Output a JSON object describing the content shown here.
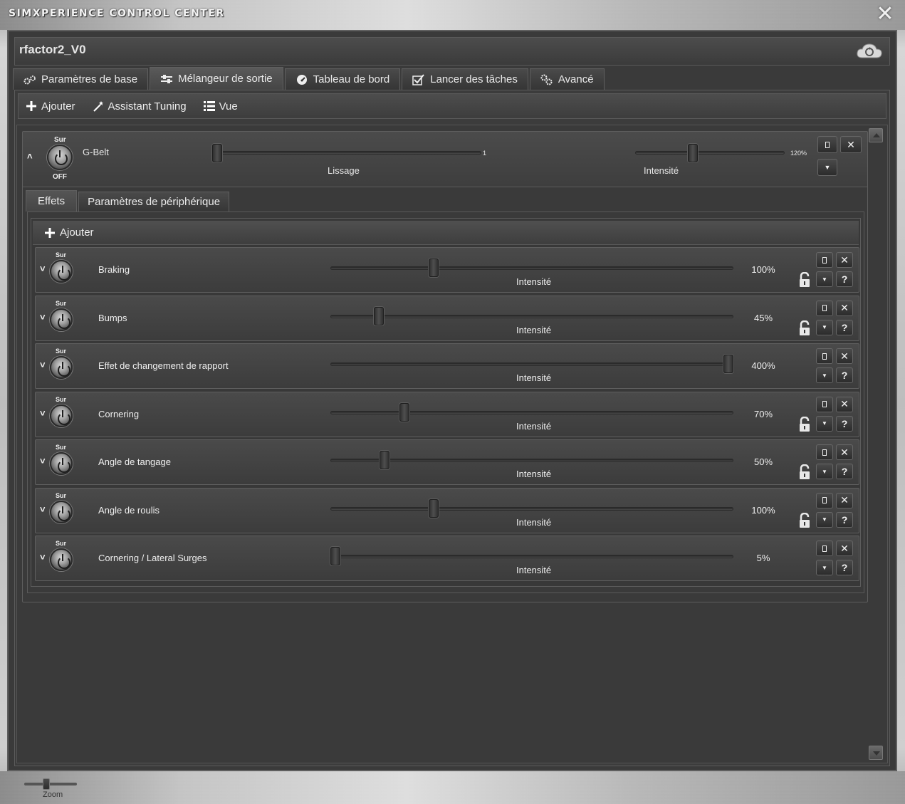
{
  "app": {
    "title": "SIMXPERIENCE CONTROL CENTER",
    "profile_name": "rfactor2_V0"
  },
  "main_tabs": [
    {
      "label": "Paramètres de base",
      "icon": "gears-icon"
    },
    {
      "label": "Mélangeur de sortie",
      "icon": "sliders-icon",
      "active": true
    },
    {
      "label": "Tableau de bord",
      "icon": "gauge-icon"
    },
    {
      "label": "Lancer des tâches",
      "icon": "checklist-icon"
    },
    {
      "label": "Avancé",
      "icon": "gears-icon"
    }
  ],
  "toolbar": {
    "add_label": "Ajouter",
    "tuning_label": "Assistant Tuning",
    "view_label": "Vue"
  },
  "device": {
    "name": "G-Belt",
    "on_label": "Sur",
    "off_label": "OFF",
    "smoothing_label": "Lissage",
    "smoothing_value": "1",
    "smoothing_fraction": 0.0,
    "intensity_label": "Intensité",
    "intensity_value": "120%",
    "intensity_fraction": 0.38
  },
  "sub_tabs": [
    {
      "label": "Effets",
      "active": true
    },
    {
      "label": "Paramètres de périphérique"
    }
  ],
  "effects_toolbar": {
    "add_label": "Ajouter"
  },
  "effects": [
    {
      "name": "Braking",
      "on_label": "Sur",
      "intensity_label": "Intensité",
      "value": "100%",
      "fraction": 0.25,
      "locked_icon": true
    },
    {
      "name": "Bumps",
      "on_label": "Sur",
      "intensity_label": "Intensité",
      "value": "45%",
      "fraction": 0.11,
      "locked_icon": true
    },
    {
      "name": "Effet de changement de rapport",
      "on_label": "Sur",
      "intensity_label": "Intensité",
      "value": "400%",
      "fraction": 1.0,
      "locked_icon": false
    },
    {
      "name": "Cornering",
      "on_label": "Sur",
      "intensity_label": "Intensité",
      "value": "70%",
      "fraction": 0.175,
      "locked_icon": true
    },
    {
      "name": "Angle de tangage",
      "on_label": "Sur",
      "intensity_label": "Intensité",
      "value": "50%",
      "fraction": 0.125,
      "locked_icon": true
    },
    {
      "name": "Angle de roulis",
      "on_label": "Sur",
      "intensity_label": "Intensité",
      "value": "100%",
      "fraction": 0.25,
      "locked_icon": true
    },
    {
      "name": "Cornering / Lateral Surges",
      "on_label": "Sur",
      "intensity_label": "Intensité",
      "value": "5%",
      "fraction": 0.0,
      "locked_icon": false
    }
  ],
  "zoom": {
    "label": "Zoom"
  },
  "colors": {
    "panel_bg": "#3a3a3a",
    "text": "#e8e8e8",
    "frame": "#5f5f5f"
  }
}
